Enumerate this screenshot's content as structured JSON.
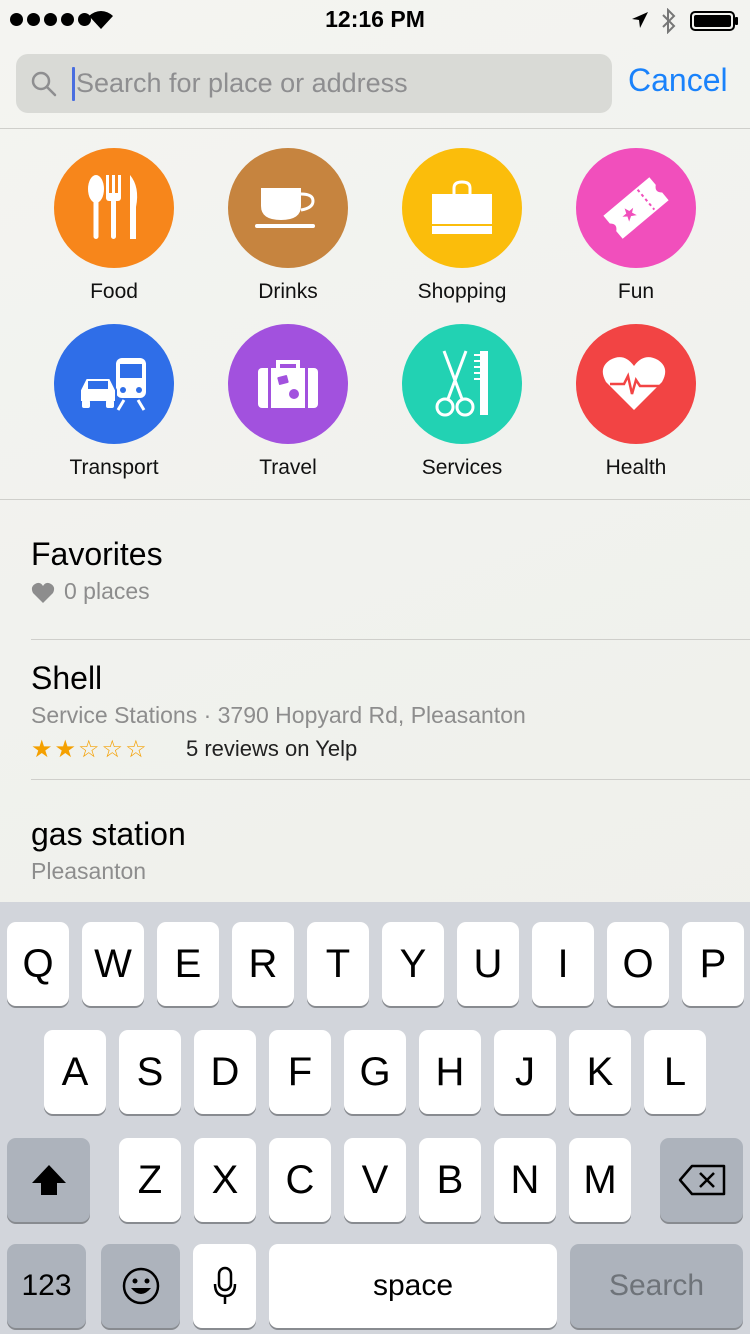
{
  "status_bar": {
    "time": "12:16 PM"
  },
  "search": {
    "placeholder": "Search for place or address",
    "cancel_label": "Cancel"
  },
  "categories": [
    {
      "label": "Food",
      "color": "#f7861b",
      "icon": "fork-knife-icon"
    },
    {
      "label": "Drinks",
      "color": "#c6843f",
      "icon": "coffee-cup-icon"
    },
    {
      "label": "Shopping",
      "color": "#fbbd0b",
      "icon": "shopping-bag-icon"
    },
    {
      "label": "Fun",
      "color": "#f14fbc",
      "icon": "ticket-icon"
    },
    {
      "label": "Transport",
      "color": "#2f6ee8",
      "icon": "car-train-icon"
    },
    {
      "label": "Travel",
      "color": "#a251de",
      "icon": "suitcase-icon"
    },
    {
      "label": "Services",
      "color": "#22d2b3",
      "icon": "scissors-comb-icon"
    },
    {
      "label": "Health",
      "color": "#f24444",
      "icon": "heart-pulse-icon"
    }
  ],
  "favorites": {
    "title": "Favorites",
    "count": "0 places"
  },
  "results": [
    {
      "title": "Shell",
      "subtitle": "Service Stations · 3790 Hopyard Rd, Pleasanton",
      "rating": 2,
      "max_rating": 5,
      "stars_text": "★★☆☆☆",
      "reviews": "5 reviews on Yelp"
    },
    {
      "title": "gas station",
      "subtitle": "Pleasanton"
    }
  ],
  "keyboard": {
    "row1": [
      "Q",
      "W",
      "E",
      "R",
      "T",
      "Y",
      "U",
      "I",
      "O",
      "P"
    ],
    "row2": [
      "A",
      "S",
      "D",
      "F",
      "G",
      "H",
      "J",
      "K",
      "L"
    ],
    "row3": [
      "Z",
      "X",
      "C",
      "V",
      "B",
      "N",
      "M"
    ],
    "numbers_label": "123",
    "space_label": "space",
    "search_label": "Search"
  }
}
